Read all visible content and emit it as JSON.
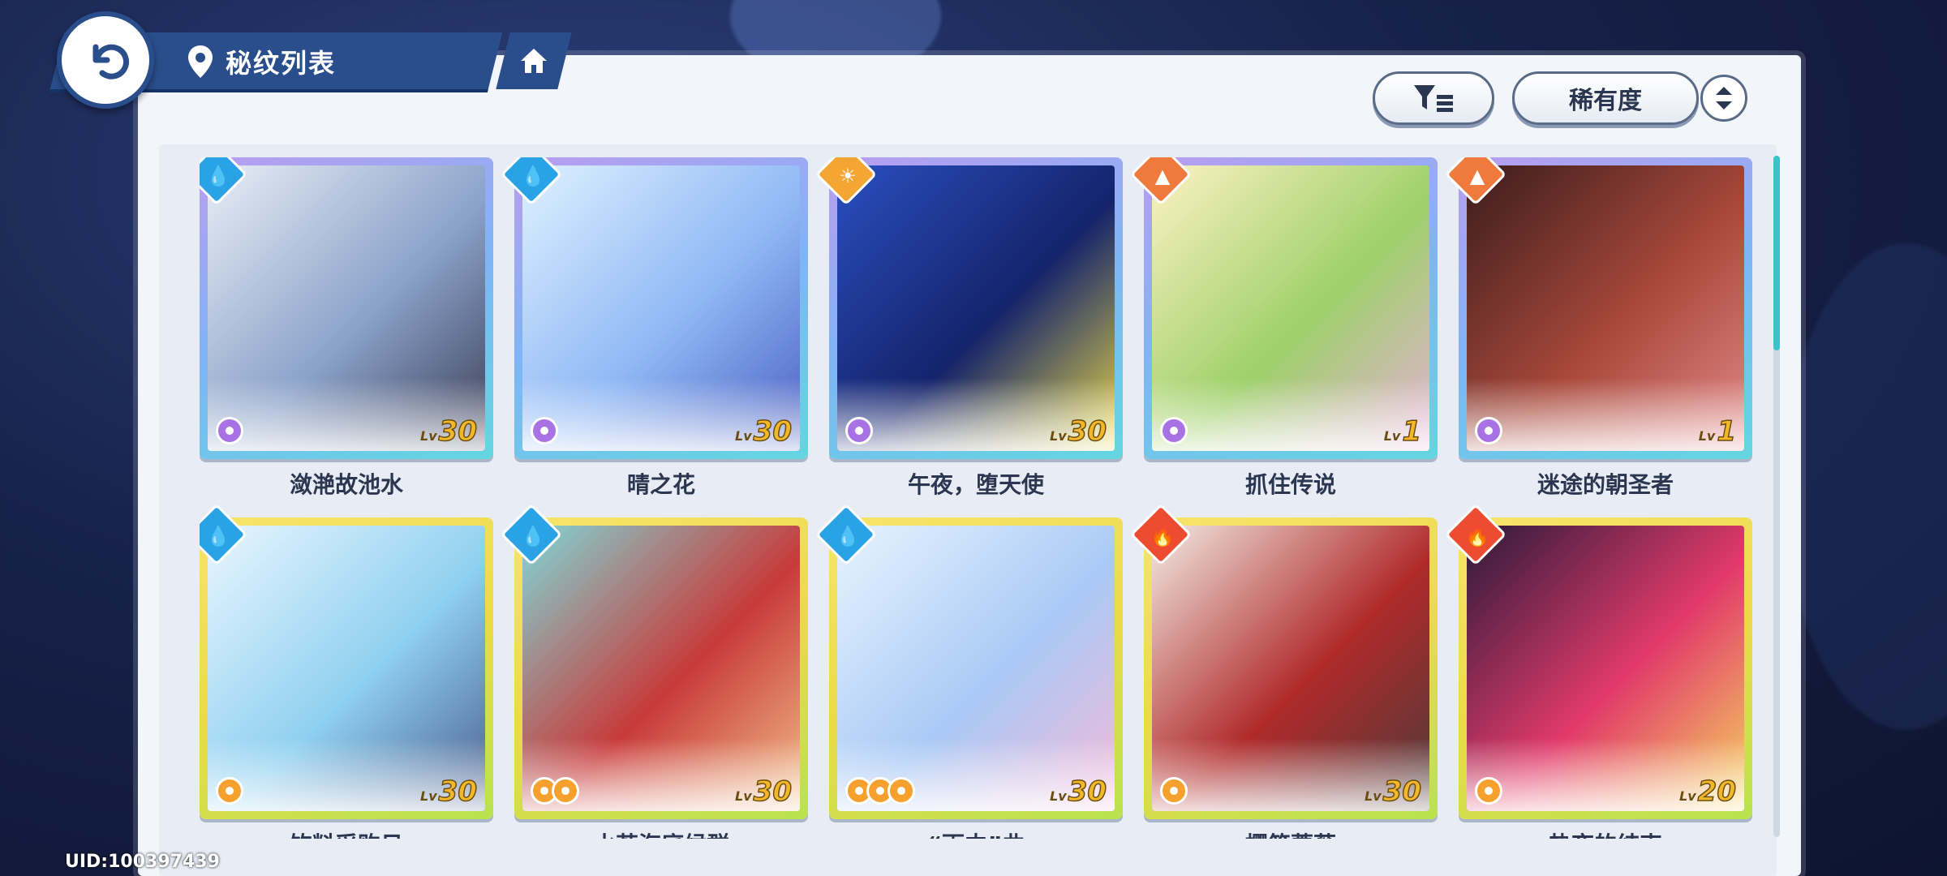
{
  "header": {
    "title": "秘纹列表",
    "back_icon": "back-arrow-icon",
    "location_icon": "map-pin-icon",
    "home_icon": "home-icon"
  },
  "toolbar": {
    "filter_icon": "filter-icon",
    "sort_label": "稀有度",
    "order_icon": "sort-order-icon"
  },
  "uid": "UID:100397439",
  "colors": {
    "accent": "#2a4d8c",
    "water": "#2aa3e6",
    "light": "#f5a532",
    "earth": "#ef7a3c",
    "fire": "#ee4c30",
    "scroll": "#38c4c8"
  },
  "cards": [
    {
      "name": "潋滟故池水",
      "lv_label": "Lv",
      "level": "30",
      "attribute": "water",
      "frame": "blue",
      "discs": 1,
      "disc_color": "purple",
      "art": [
        "#e9eef6",
        "#8ba2c9",
        "#3a3d55"
      ]
    },
    {
      "name": "晴之花",
      "lv_label": "Lv",
      "level": "30",
      "attribute": "water",
      "frame": "blue",
      "discs": 1,
      "disc_color": "purple",
      "art": [
        "#dff1ff",
        "#8fb8f5",
        "#4a5ec0"
      ]
    },
    {
      "name": "午夜，堕天使",
      "lv_label": "Lv",
      "level": "30",
      "attribute": "light",
      "frame": "blue",
      "discs": 1,
      "disc_color": "purple",
      "art": [
        "#2a4fc0",
        "#14236b",
        "#e8d848"
      ]
    },
    {
      "name": "抓住传说",
      "lv_label": "Lv",
      "level": "1",
      "attribute": "earth",
      "frame": "blue",
      "discs": 1,
      "disc_color": "purple",
      "art": [
        "#fdf2c4",
        "#9ed06a",
        "#e6b0d8"
      ]
    },
    {
      "name": "迷途的朝圣者",
      "lv_label": "Lv",
      "level": "1",
      "attribute": "earth",
      "frame": "blue",
      "discs": 1,
      "disc_color": "purple",
      "art": [
        "#3a1c1c",
        "#a8483a",
        "#e38a8a"
      ]
    },
    {
      "name": "饮料采购日",
      "lv_label": "Lv",
      "level": "30",
      "attribute": "water",
      "frame": "gold",
      "discs": 1,
      "disc_color": "orange",
      "art": [
        "#eaf6ff",
        "#8fd0f0",
        "#4a5c8c"
      ]
    },
    {
      "name": "水若海底候群",
      "lv_label": "Lv",
      "level": "30",
      "attribute": "water",
      "frame": "gold",
      "discs": 2,
      "disc_color": "orange",
      "art": [
        "#7fd8d8",
        "#c83a3a",
        "#f2c18a"
      ]
    },
    {
      "name": "“雨中”曲",
      "lv_label": "Lv",
      "level": "30",
      "attribute": "water",
      "frame": "gold",
      "discs": 3,
      "disc_color": "orange",
      "art": [
        "#e8f4ff",
        "#a9c9f5",
        "#f5b9d8"
      ]
    },
    {
      "name": "樱笼蔷薇",
      "lv_label": "Lv",
      "level": "30",
      "attribute": "fire",
      "frame": "gold",
      "discs": 1,
      "disc_color": "orange",
      "art": [
        "#f2ece4",
        "#b02a2a",
        "#4a3a3a"
      ]
    },
    {
      "name": "热夜的结束",
      "lv_label": "Lv",
      "level": "20",
      "attribute": "fire",
      "frame": "gold",
      "discs": 1,
      "disc_color": "orange",
      "art": [
        "#2a1a3a",
        "#e23a6a",
        "#f5d860"
      ]
    }
  ]
}
